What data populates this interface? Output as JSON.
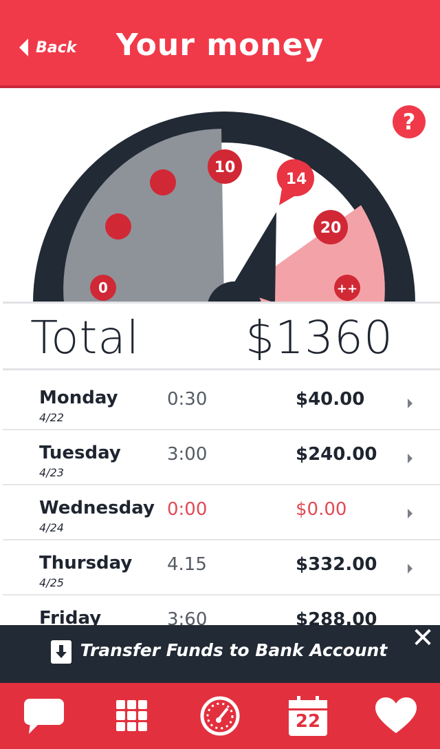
{
  "header": {
    "back_label": "Back",
    "title": "Your money"
  },
  "help": {
    "label": "?"
  },
  "gauge": {
    "markers": [
      "0",
      "10",
      "20",
      "++"
    ],
    "pointer_value": "14"
  },
  "total": {
    "label": "Total",
    "value": "$1360"
  },
  "days": [
    {
      "day": "Monday",
      "date": "4/22",
      "hours": "0:30",
      "amount": "$40.00"
    },
    {
      "day": "Tuesday",
      "date": "4/23",
      "hours": "3:00",
      "amount": "$240.00"
    },
    {
      "day": "Wednesday",
      "date": "4/24",
      "hours": "0:00",
      "amount": "$0.00"
    },
    {
      "day": "Thursday",
      "date": "4/25",
      "hours": "4.15",
      "amount": "$332.00"
    },
    {
      "day": "Friday",
      "date": "",
      "hours": "3:60",
      "amount": "$288.00"
    }
  ],
  "transfer": {
    "label": "Transfer Funds to Bank Account"
  },
  "tabbar": {
    "calendar_day": "22"
  },
  "colors": {
    "accent": "#f03a4a",
    "dark": "#212a35",
    "zero": "#e24a55"
  }
}
